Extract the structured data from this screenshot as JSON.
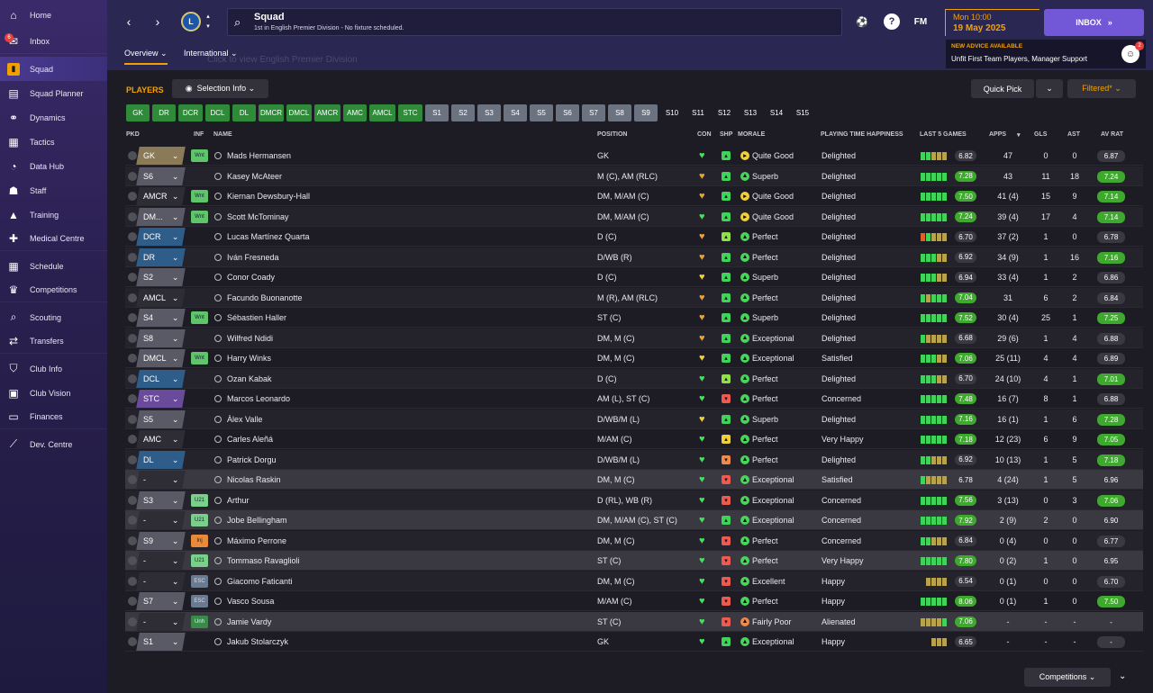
{
  "sidebar": {
    "items": [
      {
        "label": "Home",
        "icon": "home-icon",
        "glyph": "⌂"
      },
      {
        "label": "Inbox",
        "icon": "inbox-icon",
        "glyph": "✉",
        "badge": "6"
      },
      {
        "label": "Squad",
        "icon": "squad-icon",
        "glyph": "▮"
      },
      {
        "label": "Squad Planner",
        "icon": "squad-planner-icon",
        "glyph": "▤"
      },
      {
        "label": "Dynamics",
        "icon": "dynamics-icon",
        "glyph": "⚭"
      },
      {
        "label": "Tactics",
        "icon": "tactics-icon",
        "glyph": "▦"
      },
      {
        "label": "Data Hub",
        "icon": "data-hub-icon",
        "glyph": "◔"
      },
      {
        "label": "Staff",
        "icon": "staff-icon",
        "glyph": "☗"
      },
      {
        "label": "Training",
        "icon": "training-icon",
        "glyph": "▲"
      },
      {
        "label": "Medical Centre",
        "icon": "medical-icon",
        "glyph": "✚"
      },
      {
        "label": "Schedule",
        "icon": "schedule-icon",
        "glyph": "▦"
      },
      {
        "label": "Competitions",
        "icon": "trophy-icon",
        "glyph": "♛"
      },
      {
        "label": "Scouting",
        "icon": "scouting-icon",
        "glyph": "⌕"
      },
      {
        "label": "Transfers",
        "icon": "transfers-icon",
        "glyph": "⇄"
      },
      {
        "label": "Club Info",
        "icon": "club-info-icon",
        "glyph": "⛉"
      },
      {
        "label": "Club Vision",
        "icon": "club-vision-icon",
        "glyph": "▣"
      },
      {
        "label": "Finances",
        "icon": "finances-icon",
        "glyph": "▭"
      },
      {
        "label": "Dev. Centre",
        "icon": "dev-centre-icon",
        "glyph": "⟋"
      }
    ]
  },
  "header": {
    "title": "Squad",
    "subtitle": "1st in English Premier Division - No fixture scheduled.",
    "date_time": "Mon 10:00",
    "date": "19 May 2025",
    "inbox_label": "INBOX",
    "fm_label": "FM",
    "advice_title": "NEW ADVICE AVAILABLE",
    "advice_text": "Unfit First Team Players, Manager Support",
    "advice_count": "2",
    "tooltip_ghost": "Click to view English Premier Division"
  },
  "subtabs": {
    "overview": "Overview ⌄",
    "international": "International ⌄"
  },
  "toolbar": {
    "players_label": "PLAYERS",
    "selection_info": "Selection Info ⌄",
    "quick_pick": "Quick Pick",
    "filtered": "Filtered* ⌄",
    "competitions": "Competitions ⌄"
  },
  "position_chips": [
    {
      "label": "GK",
      "style": "green"
    },
    {
      "label": "DR",
      "style": "green"
    },
    {
      "label": "DCR",
      "style": "green"
    },
    {
      "label": "DCL",
      "style": "green"
    },
    {
      "label": "DL",
      "style": "green"
    },
    {
      "label": "DMCR",
      "style": "green"
    },
    {
      "label": "DMCL",
      "style": "green"
    },
    {
      "label": "AMCR",
      "style": "green"
    },
    {
      "label": "AMC",
      "style": "green"
    },
    {
      "label": "AMCL",
      "style": "green"
    },
    {
      "label": "STC",
      "style": "green"
    },
    {
      "label": "S1",
      "style": "grey"
    },
    {
      "label": "S2",
      "style": "grey"
    },
    {
      "label": "S3",
      "style": "grey"
    },
    {
      "label": "S4",
      "style": "grey"
    },
    {
      "label": "S5",
      "style": "grey"
    },
    {
      "label": "S6",
      "style": "grey"
    },
    {
      "label": "S7",
      "style": "grey"
    },
    {
      "label": "S8",
      "style": "grey"
    },
    {
      "label": "S9",
      "style": "grey"
    },
    {
      "label": "S10",
      "style": "plain"
    },
    {
      "label": "S11",
      "style": "plain"
    },
    {
      "label": "S12",
      "style": "plain"
    },
    {
      "label": "S13",
      "style": "plain"
    },
    {
      "label": "S14",
      "style": "plain"
    },
    {
      "label": "S15",
      "style": "plain"
    }
  ],
  "columns": {
    "pkd": "PKD",
    "inf": "INF",
    "name": "NAME",
    "position": "POSITION",
    "con": "CON",
    "shp": "SHP",
    "morale": "MORALE",
    "happiness": "PLAYING TIME HAPPINESS",
    "last5": "LAST 5 GAMES",
    "apps": "APPS",
    "gls": "GLS",
    "ast": "AST",
    "avrat": "AV RAT"
  },
  "colors": {
    "accent": "#f0a000",
    "inbox": "#7257d6",
    "green": "#2f8b3a",
    "positive": "#5fd43a"
  },
  "players": [
    {
      "pkd": "GK",
      "pkd_color": "#8a7a58",
      "inf": "Wnt",
      "inf_type": "wnt",
      "name": "Mads Hermansen",
      "position": "GK",
      "con": "green",
      "shp": "green",
      "morale": "Quite Good",
      "morale_type": "yellow",
      "happiness": "Delighted",
      "form": [
        "g",
        "g",
        "y",
        "y",
        "y"
      ],
      "last5": "6.82",
      "last5_good": false,
      "apps": "47",
      "gls": "0",
      "ast": "0",
      "avrat": "6.87",
      "avrat_good": false
    },
    {
      "pkd": "S6",
      "pkd_color": "#5a5a66",
      "inf": "",
      "inf_type": "",
      "name": "Kasey McAteer",
      "position": "M (C), AM (RLC)",
      "con": "orange",
      "shp": "green",
      "morale": "Superb",
      "morale_type": "green",
      "happiness": "Delighted",
      "form": [
        "g",
        "g",
        "g",
        "g",
        "g"
      ],
      "last5": "7.28",
      "last5_good": true,
      "apps": "43",
      "gls": "11",
      "ast": "18",
      "avrat": "7.24",
      "avrat_good": true
    },
    {
      "pkd": "AMCR",
      "pkd_color": "#2e2d36",
      "inf": "Wnt",
      "inf_type": "wnt",
      "name": "Kiernan Dewsbury-Hall",
      "position": "DM, M/AM (C)",
      "con": "orange",
      "shp": "green",
      "morale": "Quite Good",
      "morale_type": "yellow",
      "happiness": "Delighted",
      "form": [
        "g",
        "g",
        "g",
        "g",
        "g"
      ],
      "last5": "7.50",
      "last5_good": true,
      "apps": "41 (4)",
      "gls": "15",
      "ast": "9",
      "avrat": "7.14",
      "avrat_good": true
    },
    {
      "pkd": "DM...",
      "pkd_color": "#5a5a66",
      "inf": "Wnt",
      "inf_type": "wnt",
      "name": "Scott McTominay",
      "position": "DM, M/AM (C)",
      "con": "green",
      "shp": "green",
      "morale": "Quite Good",
      "morale_type": "yellow",
      "happiness": "Delighted",
      "form": [
        "g",
        "g",
        "g",
        "g",
        "g"
      ],
      "last5": "7.24",
      "last5_good": true,
      "apps": "39 (4)",
      "gls": "17",
      "ast": "4",
      "avrat": "7.14",
      "avrat_good": true
    },
    {
      "pkd": "DCR",
      "pkd_color": "#2f5d8a",
      "inf": "",
      "inf_type": "",
      "name": "Lucas Martínez Quarta",
      "position": "D (C)",
      "con": "orange",
      "shp": "lime",
      "morale": "Perfect",
      "morale_type": "green",
      "happiness": "Delighted",
      "form": [
        "o",
        "g",
        "y",
        "y",
        "y"
      ],
      "last5": "6.70",
      "last5_good": false,
      "apps": "37 (2)",
      "gls": "1",
      "ast": "0",
      "avrat": "6.78",
      "avrat_good": false
    },
    {
      "pkd": "DR",
      "pkd_color": "#2f5d8a",
      "inf": "",
      "inf_type": "",
      "name": "Iván Fresneda",
      "position": "D/WB (R)",
      "con": "orange",
      "shp": "green",
      "morale": "Perfect",
      "morale_type": "green",
      "happiness": "Delighted",
      "form": [
        "g",
        "g",
        "g",
        "y",
        "y"
      ],
      "last5": "6.92",
      "last5_good": false,
      "apps": "34 (9)",
      "gls": "1",
      "ast": "16",
      "avrat": "7.16",
      "avrat_good": true
    },
    {
      "pkd": "S2",
      "pkd_color": "#5a5a66",
      "inf": "",
      "inf_type": "",
      "name": "Conor Coady",
      "position": "D (C)",
      "con": "yellow",
      "shp": "green",
      "morale": "Superb",
      "morale_type": "green",
      "happiness": "Delighted",
      "form": [
        "g",
        "g",
        "g",
        "y",
        "y"
      ],
      "last5": "6.94",
      "last5_good": false,
      "apps": "33 (4)",
      "gls": "1",
      "ast": "2",
      "avrat": "6.86",
      "avrat_good": false
    },
    {
      "pkd": "AMCL",
      "pkd_color": "#2e2d36",
      "inf": "",
      "inf_type": "",
      "name": "Facundo Buonanotte",
      "position": "M (R), AM (RLC)",
      "con": "orange",
      "shp": "green",
      "morale": "Perfect",
      "morale_type": "green",
      "happiness": "Delighted",
      "form": [
        "g",
        "y",
        "g",
        "g",
        "g"
      ],
      "last5": "7.04",
      "last5_good": true,
      "apps": "31",
      "gls": "6",
      "ast": "2",
      "avrat": "6.84",
      "avrat_good": false
    },
    {
      "pkd": "S4",
      "pkd_color": "#5a5a66",
      "inf": "Wnt",
      "inf_type": "wnt",
      "name": "Sébastien Haller",
      "position": "ST (C)",
      "con": "orange",
      "shp": "green",
      "morale": "Superb",
      "morale_type": "green",
      "happiness": "Delighted",
      "form": [
        "g",
        "g",
        "g",
        "g",
        "g"
      ],
      "last5": "7.52",
      "last5_good": true,
      "apps": "30 (4)",
      "gls": "25",
      "ast": "1",
      "avrat": "7.25",
      "avrat_good": true
    },
    {
      "pkd": "S8",
      "pkd_color": "#5a5a66",
      "inf": "",
      "inf_type": "",
      "name": "Wilfred Ndidi",
      "position": "DM, M (C)",
      "con": "orange",
      "shp": "green",
      "morale": "Exceptional",
      "morale_type": "green",
      "happiness": "Delighted",
      "form": [
        "g",
        "y",
        "y",
        "y",
        "y"
      ],
      "last5": "6.68",
      "last5_good": false,
      "apps": "29 (6)",
      "gls": "1",
      "ast": "4",
      "avrat": "6.88",
      "avrat_good": false
    },
    {
      "pkd": "DMCL",
      "pkd_color": "#5a5a66",
      "inf": "Wnt",
      "inf_type": "wnt",
      "name": "Harry Winks",
      "position": "DM, M (C)",
      "con": "yellow",
      "shp": "green",
      "morale": "Exceptional",
      "morale_type": "green",
      "happiness": "Satisfied",
      "form": [
        "g",
        "g",
        "g",
        "y",
        "y"
      ],
      "last5": "7.06",
      "last5_good": true,
      "apps": "25 (11)",
      "gls": "4",
      "ast": "4",
      "avrat": "6.89",
      "avrat_good": false
    },
    {
      "pkd": "DCL",
      "pkd_color": "#2f5d8a",
      "inf": "",
      "inf_type": "",
      "name": "Ozan Kabak",
      "position": "D (C)",
      "con": "green",
      "shp": "lime",
      "morale": "Perfect",
      "morale_type": "green",
      "happiness": "Delighted",
      "form": [
        "g",
        "g",
        "g",
        "y",
        "y"
      ],
      "last5": "6.70",
      "last5_good": false,
      "apps": "24 (10)",
      "gls": "4",
      "ast": "1",
      "avrat": "7.01",
      "avrat_good": true
    },
    {
      "pkd": "STC",
      "pkd_color": "#6a4a9a",
      "inf": "",
      "inf_type": "",
      "name": "Marcos Leonardo",
      "position": "AM (L), ST (C)",
      "con": "green",
      "shp": "red",
      "morale": "Perfect",
      "morale_type": "green",
      "happiness": "Concerned",
      "form": [
        "g",
        "g",
        "g",
        "g",
        "g"
      ],
      "last5": "7.48",
      "last5_good": true,
      "apps": "16 (7)",
      "gls": "8",
      "ast": "1",
      "avrat": "6.88",
      "avrat_good": false
    },
    {
      "pkd": "S5",
      "pkd_color": "#5a5a66",
      "inf": "",
      "inf_type": "",
      "name": "Àlex Valle",
      "position": "D/WB/M (L)",
      "con": "yellow",
      "shp": "green",
      "morale": "Superb",
      "morale_type": "green",
      "happiness": "Delighted",
      "form": [
        "g",
        "g",
        "g",
        "g",
        "g"
      ],
      "last5": "7.16",
      "last5_good": true,
      "apps": "16 (1)",
      "gls": "1",
      "ast": "6",
      "avrat": "7.28",
      "avrat_good": true
    },
    {
      "pkd": "AMC",
      "pkd_color": "#2e2d36",
      "inf": "",
      "inf_type": "",
      "name": "Carles Aleñá",
      "position": "M/AM (C)",
      "con": "green",
      "shp": "yellow",
      "morale": "Perfect",
      "morale_type": "green",
      "happiness": "Very Happy",
      "form": [
        "g",
        "g",
        "g",
        "g",
        "g"
      ],
      "last5": "7.18",
      "last5_good": true,
      "apps": "12 (23)",
      "gls": "6",
      "ast": "9",
      "avrat": "7.05",
      "avrat_good": true
    },
    {
      "pkd": "DL",
      "pkd_color": "#2f5d8a",
      "inf": "",
      "inf_type": "",
      "name": "Patrick Dorgu",
      "position": "D/WB/M (L)",
      "con": "green",
      "shp": "orange",
      "morale": "Perfect",
      "morale_type": "green",
      "happiness": "Delighted",
      "form": [
        "g",
        "g",
        "y",
        "y",
        "y"
      ],
      "last5": "6.92",
      "last5_good": false,
      "apps": "10 (13)",
      "gls": "1",
      "ast": "5",
      "avrat": "7.18",
      "avrat_good": true
    },
    {
      "pkd": "-",
      "pkd_color": "#2e2d36",
      "inf": "",
      "inf_type": "",
      "name": "Nicolas Raskin",
      "position": "DM, M (C)",
      "con": "green",
      "shp": "red",
      "morale": "Exceptional",
      "morale_type": "green",
      "happiness": "Satisfied",
      "form": [
        "g",
        "y",
        "y",
        "y",
        "y"
      ],
      "last5": "6.78",
      "last5_good": false,
      "apps": "4 (24)",
      "gls": "1",
      "ast": "5",
      "avrat": "6.96",
      "avrat_good": false
    },
    {
      "pkd": "S3",
      "pkd_color": "#5a5a66",
      "inf": "U21",
      "inf_type": "u21",
      "name": "Arthur",
      "position": "D (RL), WB (R)",
      "con": "green",
      "shp": "red",
      "morale": "Exceptional",
      "morale_type": "green",
      "happiness": "Concerned",
      "form": [
        "g",
        "g",
        "g",
        "g",
        "g"
      ],
      "last5": "7.56",
      "last5_good": true,
      "apps": "3 (13)",
      "gls": "0",
      "ast": "3",
      "avrat": "7.06",
      "avrat_good": true
    },
    {
      "pkd": "-",
      "pkd_color": "#2e2d36",
      "inf": "U21",
      "inf_type": "u21",
      "name": "Jobe Bellingham",
      "position": "DM, M/AM (C), ST (C)",
      "con": "green",
      "shp": "green",
      "morale": "Exceptional",
      "morale_type": "green",
      "happiness": "Concerned",
      "form": [
        "g",
        "g",
        "g",
        "g",
        "g"
      ],
      "last5": "7.92",
      "last5_good": true,
      "apps": "2 (9)",
      "gls": "2",
      "ast": "0",
      "avrat": "6.90",
      "avrat_good": false
    },
    {
      "pkd": "S9",
      "pkd_color": "#5a5a66",
      "inf": "Inj",
      "inf_type": "inj",
      "name": "Máximo Perrone",
      "position": "DM, M (C)",
      "con": "green",
      "shp": "red",
      "morale": "Perfect",
      "morale_type": "green",
      "happiness": "Concerned",
      "form": [
        "g",
        "g",
        "y",
        "y",
        "y"
      ],
      "last5": "6.84",
      "last5_good": false,
      "apps": "0 (4)",
      "gls": "0",
      "ast": "0",
      "avrat": "6.77",
      "avrat_good": false
    },
    {
      "pkd": "-",
      "pkd_color": "#2e2d36",
      "inf": "U21",
      "inf_type": "u21",
      "name": "Tommaso Ravaglioli",
      "position": "ST (C)",
      "con": "green",
      "shp": "red",
      "morale": "Perfect",
      "morale_type": "green",
      "happiness": "Very Happy",
      "form": [
        "g",
        "g",
        "g",
        "g",
        "g"
      ],
      "last5": "7.80",
      "last5_good": true,
      "apps": "0 (2)",
      "gls": "1",
      "ast": "0",
      "avrat": "6.95",
      "avrat_good": false
    },
    {
      "pkd": "-",
      "pkd_color": "#2e2d36",
      "inf": "ESC",
      "inf_type": "esc",
      "name": "Giacomo Faticanti",
      "position": "DM, M (C)",
      "con": "green",
      "shp": "red",
      "morale": "Excellent",
      "morale_type": "green",
      "happiness": "Happy",
      "form": [
        "y",
        "y",
        "y",
        "y"
      ],
      "last5": "6.54",
      "last5_good": false,
      "apps": "0 (1)",
      "gls": "0",
      "ast": "0",
      "avrat": "6.70",
      "avrat_good": false
    },
    {
      "pkd": "S7",
      "pkd_color": "#5a5a66",
      "inf": "ESC",
      "inf_type": "esc",
      "name": "Vasco Sousa",
      "position": "M/AM (C)",
      "con": "green",
      "shp": "red",
      "morale": "Perfect",
      "morale_type": "green",
      "happiness": "Happy",
      "form": [
        "g",
        "g",
        "g",
        "g",
        "g"
      ],
      "last5": "8.06",
      "last5_good": true,
      "apps": "0 (1)",
      "gls": "1",
      "ast": "0",
      "avrat": "7.50",
      "avrat_good": true
    },
    {
      "pkd": "-",
      "pkd_color": "#2e2d36",
      "inf": "Unh",
      "inf_type": "unh",
      "name": "Jamie Vardy",
      "position": "ST (C)",
      "con": "green",
      "shp": "red",
      "morale": "Fairly Poor",
      "morale_type": "orange",
      "happiness": "Alienated",
      "form": [
        "y",
        "y",
        "y",
        "y",
        "g"
      ],
      "last5": "7.06",
      "last5_good": true,
      "apps": "-",
      "gls": "-",
      "ast": "-",
      "avrat": "-",
      "avrat_good": false
    },
    {
      "pkd": "S1",
      "pkd_color": "#5a5a66",
      "inf": "",
      "inf_type": "",
      "name": "Jakub Stolarczyk",
      "position": "GK",
      "con": "green",
      "shp": "green",
      "morale": "Exceptional",
      "morale_type": "green",
      "happiness": "Happy",
      "form": [
        "y",
        "y",
        "y"
      ],
      "last5": "6.65",
      "last5_good": false,
      "apps": "-",
      "gls": "-",
      "ast": "-",
      "avrat": "-",
      "avrat_good": false
    }
  ]
}
